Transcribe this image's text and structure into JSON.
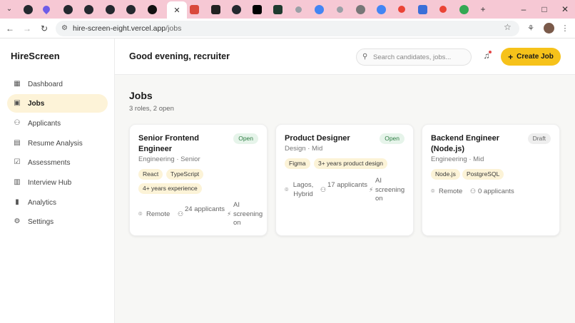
{
  "browser": {
    "url_host": "hire-screen-eight.vercel.app",
    "url_path": "/jobs",
    "tabs": [
      {
        "icon": "github-icon"
      },
      {
        "icon": "drop-icon"
      },
      {
        "icon": "github-icon"
      },
      {
        "icon": "github-icon"
      },
      {
        "icon": "github-icon"
      },
      {
        "icon": "github-icon"
      },
      {
        "icon": "github-icon"
      },
      {
        "icon": "close-icon"
      },
      {
        "icon": "gmail-icon"
      },
      {
        "icon": "app-icon"
      },
      {
        "icon": "github-icon"
      },
      {
        "icon": "x-icon"
      },
      {
        "icon": "app-icon"
      },
      {
        "icon": "site-icon"
      },
      {
        "icon": "site-icon"
      },
      {
        "icon": "site-icon"
      },
      {
        "icon": "chrome-icon"
      },
      {
        "icon": "google-icon"
      },
      {
        "icon": "google-icon"
      },
      {
        "icon": "app-icon"
      },
      {
        "icon": "google-icon"
      },
      {
        "icon": "site-icon"
      }
    ]
  },
  "app": {
    "brand": "HireScreen",
    "nav": [
      {
        "label": "Dashboard",
        "icon": "grid-icon",
        "active": false
      },
      {
        "label": "Jobs",
        "icon": "briefcase-icon",
        "active": true
      },
      {
        "label": "Applicants",
        "icon": "users-icon",
        "active": false
      },
      {
        "label": "Resume Analysis",
        "icon": "document-icon",
        "active": false
      },
      {
        "label": "Assessments",
        "icon": "clipboard-icon",
        "active": false
      },
      {
        "label": "Interview Hub",
        "icon": "calendar-icon",
        "active": false
      },
      {
        "label": "Analytics",
        "icon": "chart-icon",
        "active": false
      },
      {
        "label": "Settings",
        "icon": "gear-icon",
        "active": false
      }
    ],
    "header": {
      "greeting": "Good evening, recruiter",
      "search_placeholder": "Search candidates, jobs...",
      "create_label": "Create Job"
    },
    "page": {
      "title": "Jobs",
      "subtitle": "3 roles, 2 open"
    },
    "jobs": [
      {
        "title": "Senior Frontend Engineer",
        "meta": "Engineering · Senior",
        "status": "Open",
        "tags": [
          "React",
          "TypeScript",
          "4+ years experience"
        ],
        "location": "Remote",
        "applicants": "24 applicants",
        "screening": "AI screening on"
      },
      {
        "title": "Product Designer",
        "meta": "Design · Mid",
        "status": "Open",
        "tags": [
          "Figma",
          "3+ years product design"
        ],
        "location": "Lagos, Hybrid",
        "applicants": "17 applicants",
        "screening": "AI screening on"
      },
      {
        "title": "Backend Engineer (Node.js)",
        "meta": "Engineering · Mid",
        "status": "Draft",
        "tags": [
          "Node.js",
          "PostgreSQL"
        ],
        "location": "Remote",
        "applicants": "0 applicants"
      }
    ],
    "colors": {
      "accent": "#f6c21a",
      "active_nav_bg": "#fdf3d8",
      "tag_bg": "#fcf3d7",
      "open_bg": "#e6f4ea",
      "open_text": "#2e7d43"
    }
  }
}
